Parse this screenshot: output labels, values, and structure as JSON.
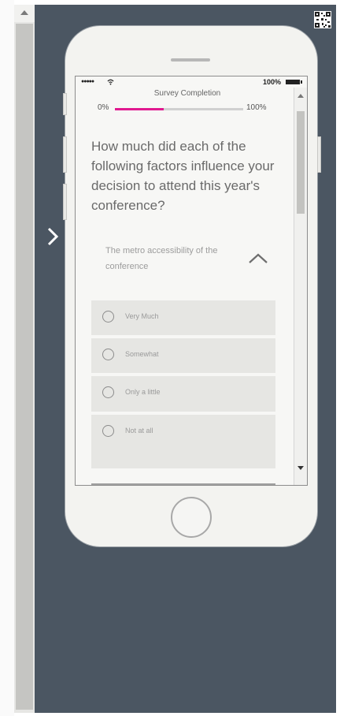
{
  "status_bar": {
    "signal": "●●●●●",
    "wifi_icon": "wifi-icon",
    "battery_percent": "100%"
  },
  "survey": {
    "progress_title": "Survey Completion",
    "progress_start_label": "0%",
    "progress_end_label": "100%",
    "progress_fraction": 0.38,
    "progress_color": "#e0198f",
    "question": "How much did each of the following factors influence your decision to attend this year's conference?",
    "factor_label": "The metro accessibility of the conference",
    "options": [
      {
        "label": "Very Much"
      },
      {
        "label": "Somewhat"
      },
      {
        "label": "Only a little"
      },
      {
        "label": "Not at all"
      }
    ]
  },
  "colors": {
    "stage_background": "#4b5662",
    "phone_body": "#f3f3f0",
    "accent": "#e0198f"
  },
  "icons": {
    "next": "chevron-right-icon",
    "collapse": "chevron-up-icon",
    "qr": "qr-code-icon"
  }
}
